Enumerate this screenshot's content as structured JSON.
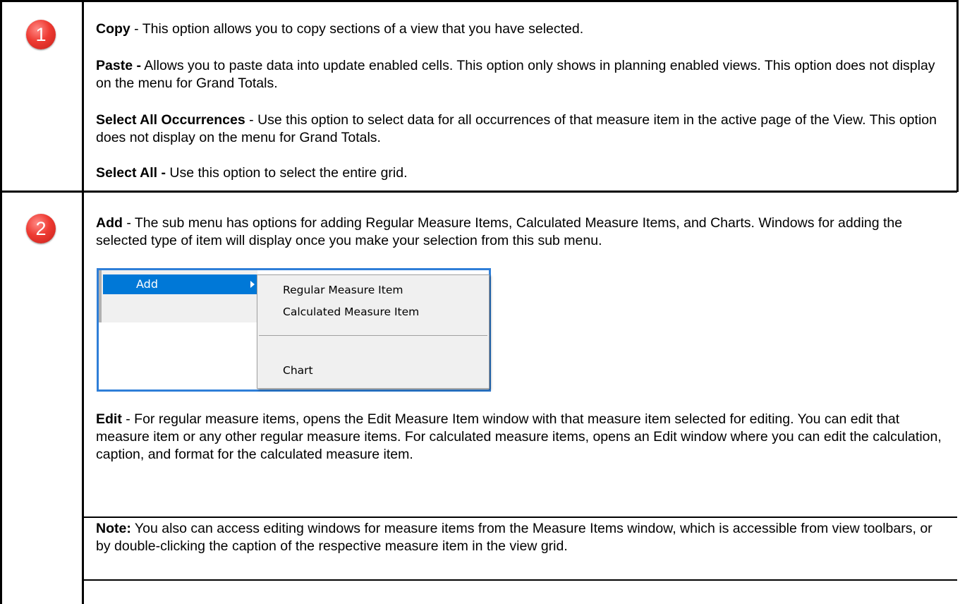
{
  "row1": {
    "badge": "1",
    "items": [
      {
        "term": "Copy",
        "text": " - This option allows you to copy sections of a view that you have selected."
      },
      {
        "term": "Paste -",
        "text": " Allows you to paste data into update enabled cells. This option only shows in planning enabled views. This option does not display on the menu for Grand Totals."
      },
      {
        "term": "Select All Occurrences",
        "text": " - Use this option to select data for all occurrences of that measure item in the active page of the View. This option does not display on the menu for Grand Totals."
      },
      {
        "term": "Select All -",
        "text": " Use this option to select the entire grid."
      }
    ]
  },
  "row2": {
    "badge": "2",
    "add": {
      "term": "Add",
      "text": " - The sub menu has options for adding Regular Measure Items, Calculated Measure Items, and Charts. Windows for adding the selected type of item will display once you make your selection from this sub menu."
    },
    "menu": {
      "item": "Add",
      "submenu": [
        "Regular Measure Item",
        "Calculated Measure Item",
        "Chart"
      ],
      "accent": "#0078d7"
    },
    "edit": {
      "term": "Edit",
      "text": " - For regular measure items, opens the Edit Measure Item window with that measure item selected for editing. You can edit that measure item or any other regular measure items. For calculated measure items, opens an Edit window where you can edit the calculation, caption, and format for the calculated measure item."
    },
    "note": {
      "term": "Note:",
      "text": " You also can access editing windows for measure items from the Measure Items window, which is accessible from view toolbars, or by double-clicking the caption of the respective measure item in the view grid."
    }
  },
  "colors": {
    "badge": "#e8322b",
    "menu_border": "#2f7fd8"
  }
}
